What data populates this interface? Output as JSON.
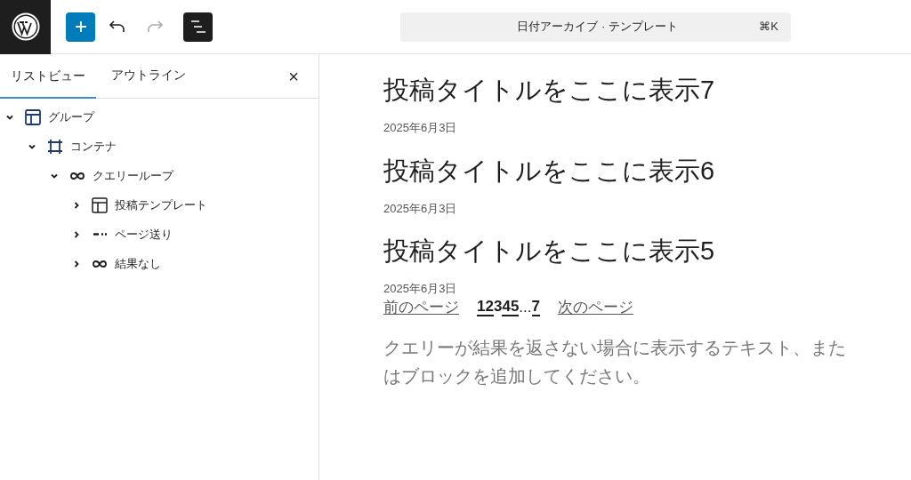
{
  "header": {
    "command_bar": {
      "title": "日付アーカイブ · テンプレート",
      "shortcut": "⌘K"
    }
  },
  "sidebar": {
    "tabs": [
      {
        "label": "リストビュー",
        "selected": true
      },
      {
        "label": "アウトライン",
        "selected": false
      }
    ],
    "close": "×",
    "tree": [
      {
        "label": "グループ",
        "kind": "group",
        "expanded": true,
        "children": [
          {
            "label": "コンテナ",
            "kind": "container",
            "expanded": true,
            "children": [
              {
                "label": "クエリーループ",
                "kind": "loop",
                "expanded": true,
                "children": [
                  {
                    "label": "投稿テンプレート",
                    "kind": "template",
                    "expanded": false
                  },
                  {
                    "label": "ページ送り",
                    "kind": "pagination",
                    "expanded": false
                  },
                  {
                    "label": "結果なし",
                    "kind": "loop",
                    "expanded": false
                  }
                ]
              }
            ]
          }
        ]
      }
    ]
  },
  "posts": [
    {
      "title": "投稿タイトルをここに表示7",
      "date": "2025年6月3日"
    },
    {
      "title": "投稿タイトルをここに表示6",
      "date": "2025年6月3日"
    },
    {
      "title": "投稿タイトルをここに表示5",
      "date": "2025年6月3日"
    }
  ],
  "pagination": {
    "previous": "前のページ",
    "next": "次のページ",
    "pages": [
      {
        "label": "1",
        "kind": "page",
        "selected": false
      },
      {
        "label": "2",
        "kind": "page",
        "selected": false
      },
      {
        "label": "3",
        "kind": "page",
        "selected": true
      },
      {
        "label": "4",
        "kind": "page",
        "selected": false
      },
      {
        "label": "5",
        "kind": "page",
        "selected": false
      },
      {
        "label": "...",
        "kind": "ellipsis"
      },
      {
        "label": "7",
        "kind": "page",
        "selected": false
      }
    ]
  },
  "no_results": "クエリーが結果を返さない場合に表示するテキスト、またはブロックを追加してください。"
}
